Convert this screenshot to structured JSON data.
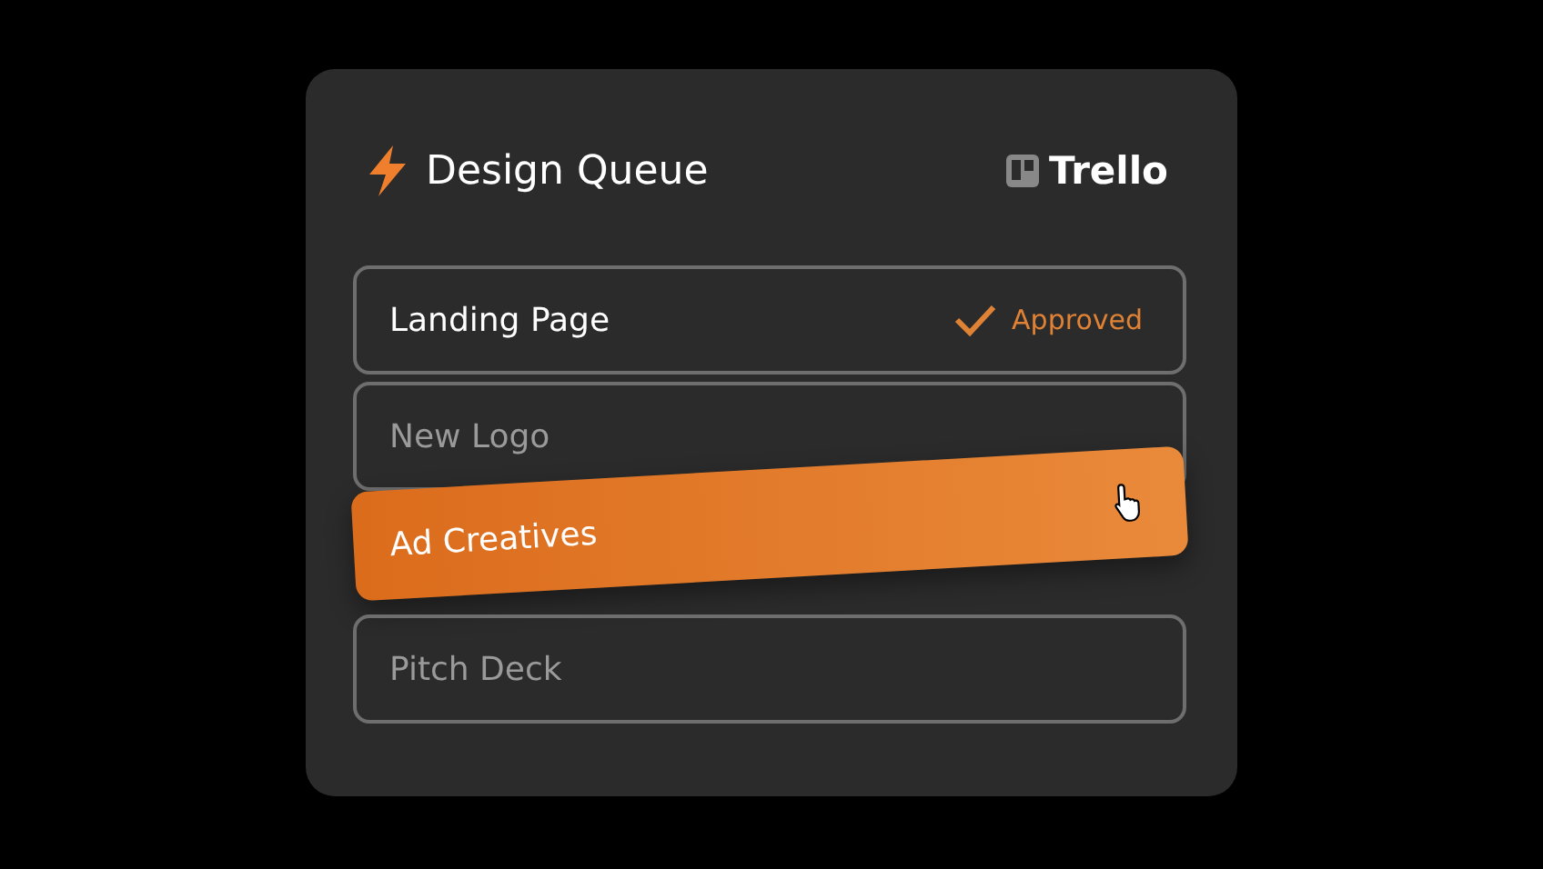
{
  "header": {
    "title": "Design Queue",
    "brand": "Trello"
  },
  "items": [
    {
      "label": "Landing Page",
      "kind": "approved",
      "status": "Approved"
    },
    {
      "label": "New Logo",
      "kind": "pending"
    },
    {
      "label": "Ad Creatives",
      "kind": "dragging"
    },
    {
      "label": "Pitch Deck",
      "kind": "pending"
    }
  ]
}
